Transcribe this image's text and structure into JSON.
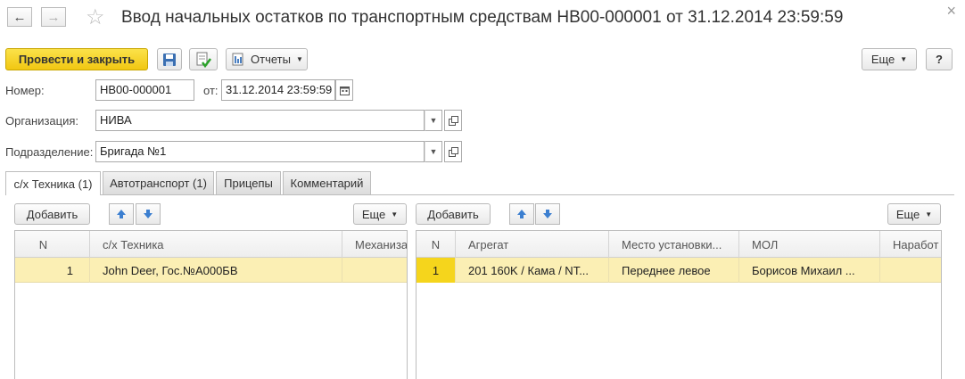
{
  "window": {
    "title": "Ввод начальных остатков по транспортным средствам НВ00-000001 от 31.12.2014 23:59:59",
    "close": "×"
  },
  "toolbar": {
    "post_close": "Провести и закрыть",
    "reports": "Отчеты",
    "more": "Еще",
    "help": "?"
  },
  "form": {
    "number_label": "Номер:",
    "number_value": "НВ00-000001",
    "date_label": "от:",
    "date_value": "31.12.2014 23:59:59",
    "org_label": "Организация:",
    "org_value": "НИВА",
    "dept_label": "Подразделение:",
    "dept_value": "Бригада №1"
  },
  "tabs": [
    {
      "label": "с/х Техника (1)"
    },
    {
      "label": "Автотранспорт (1)"
    },
    {
      "label": "Прицепы"
    },
    {
      "label": "Комментарий"
    }
  ],
  "left_panel": {
    "add": "Добавить",
    "more": "Еще",
    "columns": [
      "N",
      "с/х Техника",
      "Механиза"
    ],
    "rows": [
      {
        "n": "1",
        "machine": "John Deer, Гос.№А000БВ",
        "mech": ""
      }
    ]
  },
  "right_panel": {
    "add": "Добавить",
    "more": "Еще",
    "columns": [
      "N",
      "Агрегат",
      "Место установки...",
      "МОЛ",
      "Наработ"
    ],
    "rows": [
      {
        "n": "1",
        "unit": "201 160K / Кама / NT...",
        "place": "Переднее левое",
        "mol": "Борисов Михаил ...",
        "work": ""
      }
    ]
  },
  "colors": {
    "primary_button": "#f5d51c",
    "selected_row": "#fbefb4",
    "selected_cell": "#f5d51c"
  }
}
